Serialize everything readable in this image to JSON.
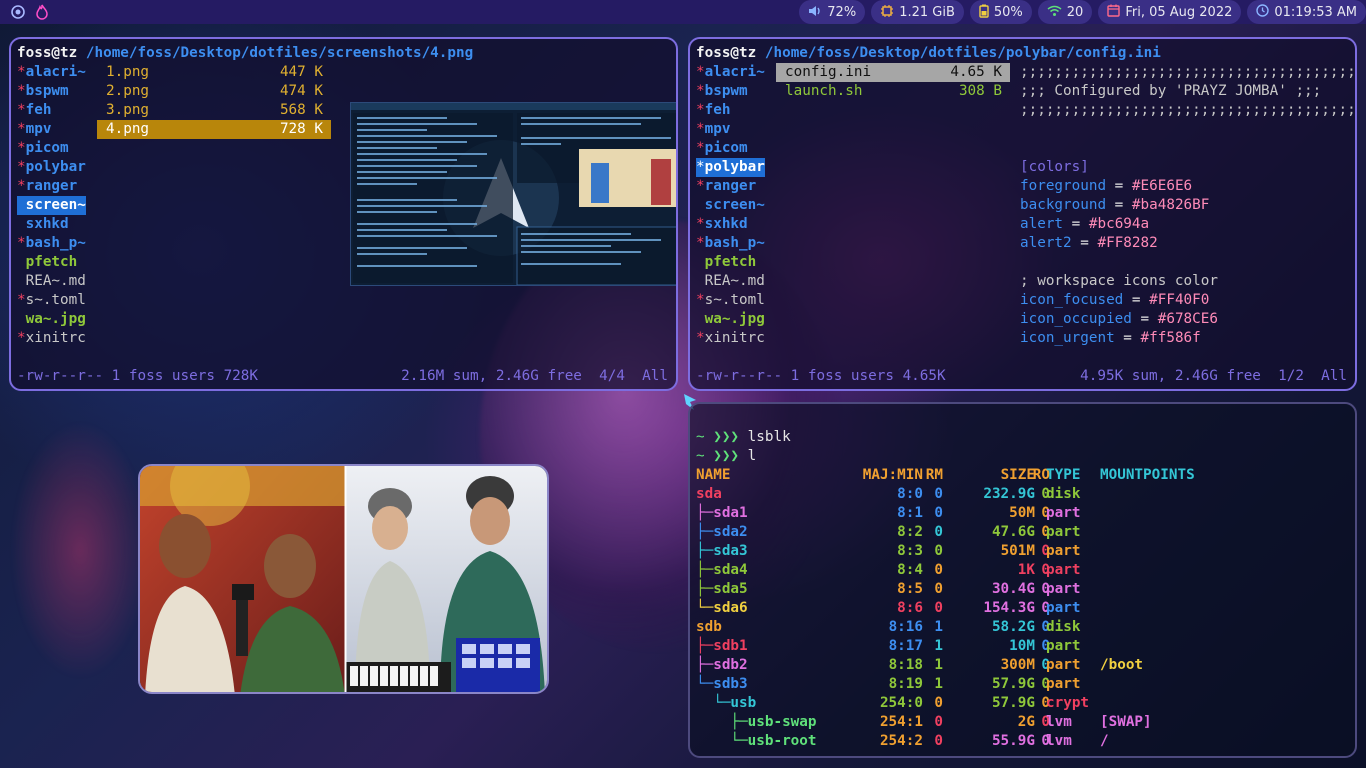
{
  "topbar": {
    "volume": "72%",
    "memory": "1.21 GiB",
    "battery": "50%",
    "wifi": "20",
    "date": "Fri, 05 Aug 2022",
    "time": "01:19:53 AM",
    "colors": {
      "bg": "#251b63",
      "pill": "#3a2f86"
    }
  },
  "ranger1": {
    "user": "foss@tz",
    "path": "/home/foss/Desktop/dotfiles/screenshots/4.png",
    "dirs": [
      {
        "label": "*alacri~"
      },
      {
        "label": "*bspwm"
      },
      {
        "label": "*feh"
      },
      {
        "label": "*mpv"
      },
      {
        "label": "*picom"
      },
      {
        "label": "*polybar"
      },
      {
        "label": "*ranger"
      },
      {
        "label": " screen~"
      },
      {
        "label": " sxhkd"
      },
      {
        "label": "*bash_p~"
      },
      {
        "label": " pfetch"
      },
      {
        "label": " REA~.md"
      },
      {
        "label": "*s~.toml"
      },
      {
        "label": " wa~.jpg"
      },
      {
        "label": "*xinitrc"
      }
    ],
    "files": [
      {
        "name": "1.png",
        "size": "447 K"
      },
      {
        "name": "2.png",
        "size": "474 K"
      },
      {
        "name": "3.png",
        "size": "568 K"
      },
      {
        "name": "4.png",
        "size": "728 K"
      }
    ],
    "status_left": "-rw-r--r-- 1 foss users 728K",
    "status_right": "2.16M sum, 2.46G free  4/4  All"
  },
  "ranger2": {
    "user": "foss@tz",
    "path": "/home/foss/Desktop/dotfiles/polybar/config.ini",
    "dirs": [
      {
        "label": "*alacri~"
      },
      {
        "label": "*bspwm"
      },
      {
        "label": "*feh"
      },
      {
        "label": "*mpv"
      },
      {
        "label": "*picom"
      },
      {
        "label": "*polybar"
      },
      {
        "label": "*ranger"
      },
      {
        "label": " screen~"
      },
      {
        "label": "*sxhkd"
      },
      {
        "label": "*bash_p~"
      },
      {
        "label": " pfetch"
      },
      {
        "label": " REA~.md"
      },
      {
        "label": "*s~.toml"
      },
      {
        "label": " wa~.jpg"
      },
      {
        "label": "*xinitrc"
      }
    ],
    "files": [
      {
        "name": "config.ini",
        "size": "4.65 K"
      },
      {
        "name": "launch.sh",
        "size": "308 B"
      }
    ],
    "preview": {
      "semis": ";;;;;;;;;;;;;;;;;;;;;;;;;;;;;;;;;;;;;;;;",
      "configured": ";;; Configured by 'PRAYZ JOMBA' ;;;",
      "section": "[colors]",
      "lines": [
        {
          "key": "foreground",
          "val": "#E6E6E6"
        },
        {
          "key": "background",
          "val": "#ba4826BF"
        },
        {
          "key": "alert",
          "val": "#bc694a"
        },
        {
          "key": "alert2",
          "val": "#FF8282"
        }
      ],
      "comment": "; workspace icons color",
      "icons": [
        {
          "key": "icon_focused",
          "val": "#FF40F0"
        },
        {
          "key": "icon_occupied",
          "val": "#678CE6"
        },
        {
          "key": "icon_urgent",
          "val": "#ff586f"
        }
      ]
    },
    "status_left": "-rw-r--r-- 1 foss users 4.65K",
    "status_right": "4.95K sum, 2.46G free  1/2  All"
  },
  "shell": {
    "prompt": "~ ❯❯❯",
    "cmd1": "lsblk",
    "cmd2": "l",
    "headers": {
      "name": "NAME",
      "maj": "MAJ:MIN",
      "rm": "RM",
      "size": "SIZE",
      "ro": "RO",
      "type": "TYPE",
      "mount": "MOUNTPOINTS"
    },
    "rows": [
      {
        "name": "sda",
        "maj": "8:0",
        "rm": "0",
        "size": "232.9G",
        "ro": "0",
        "type": "disk",
        "mount": ""
      },
      {
        "name": "├─sda1",
        "maj": "8:1",
        "rm": "0",
        "size": "50M",
        "ro": "0",
        "type": "part",
        "mount": ""
      },
      {
        "name": "├─sda2",
        "maj": "8:2",
        "rm": "0",
        "size": "47.6G",
        "ro": "0",
        "type": "part",
        "mount": ""
      },
      {
        "name": "├─sda3",
        "maj": "8:3",
        "rm": "0",
        "size": "501M",
        "ro": "0",
        "type": "part",
        "mount": ""
      },
      {
        "name": "├─sda4",
        "maj": "8:4",
        "rm": "0",
        "size": "1K",
        "ro": "0",
        "type": "part",
        "mount": ""
      },
      {
        "name": "├─sda5",
        "maj": "8:5",
        "rm": "0",
        "size": "30.4G",
        "ro": "0",
        "type": "part",
        "mount": ""
      },
      {
        "name": "└─sda6",
        "maj": "8:6",
        "rm": "0",
        "size": "154.3G",
        "ro": "0",
        "type": "part",
        "mount": ""
      },
      {
        "name": "sdb",
        "maj": "8:16",
        "rm": "1",
        "size": "58.2G",
        "ro": "0",
        "type": "disk",
        "mount": ""
      },
      {
        "name": "├─sdb1",
        "maj": "8:17",
        "rm": "1",
        "size": "10M",
        "ro": "0",
        "type": "part",
        "mount": ""
      },
      {
        "name": "├─sdb2",
        "maj": "8:18",
        "rm": "1",
        "size": "300M",
        "ro": "0",
        "type": "part",
        "mount": "/boot"
      },
      {
        "name": "└─sdb3",
        "maj": "8:19",
        "rm": "1",
        "size": "57.9G",
        "ro": "0",
        "type": "part",
        "mount": ""
      },
      {
        "name": "  └─usb",
        "maj": "254:0",
        "rm": "0",
        "size": "57.9G",
        "ro": "0",
        "type": "crypt",
        "mount": ""
      },
      {
        "name": "    ├─usb-swap",
        "maj": "254:1",
        "rm": "0",
        "size": "2G",
        "ro": "0",
        "type": "lvm",
        "mount": "[SWAP]"
      },
      {
        "name": "    └─usb-root",
        "maj": "254:2",
        "rm": "0",
        "size": "55.9G",
        "ro": "0",
        "type": "lvm",
        "mount": "/"
      }
    ]
  }
}
